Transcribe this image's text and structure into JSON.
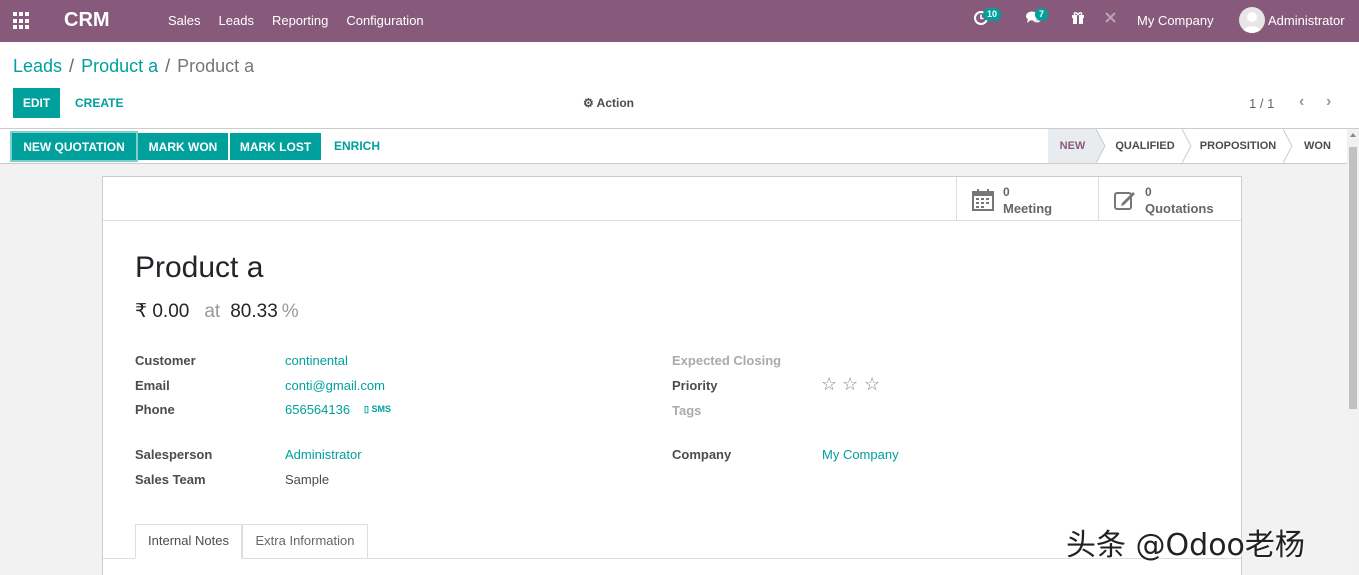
{
  "navbar": {
    "brand": "CRM",
    "menu": [
      "Sales",
      "Leads",
      "Reporting",
      "Configuration"
    ],
    "activity_count": "10",
    "message_count": "7",
    "company": "My Company",
    "user": "Administrator"
  },
  "breadcrumb": {
    "items": [
      "Leads",
      "Product a"
    ],
    "current": "Product a"
  },
  "buttons": {
    "edit": "EDIT",
    "create": "CREATE",
    "action": "Action",
    "new_quotation": "NEW QUOTATION",
    "mark_won": "MARK WON",
    "mark_lost": "MARK LOST",
    "enrich": "ENRICH"
  },
  "pager": {
    "value": "1 / 1"
  },
  "stages": {
    "items": [
      "NEW",
      "QUALIFIED",
      "PROPOSITION",
      "WON"
    ],
    "active": "NEW"
  },
  "smart_buttons": [
    {
      "value": "0",
      "label": "Meeting"
    },
    {
      "value": "0",
      "label": "Quotations"
    }
  ],
  "record": {
    "name": "Product a",
    "revenue": "₹ 0.00",
    "at": "at",
    "probability": "80.33",
    "percent": "%"
  },
  "fields": {
    "customer_label": "Customer",
    "customer": "continental",
    "email_label": "Email",
    "email": "conti@gmail.com",
    "phone_label": "Phone",
    "phone": "656564136",
    "sms": "SMS",
    "salesperson_label": "Salesperson",
    "salesperson": "Administrator",
    "sales_team_label": "Sales Team",
    "sales_team": "Sample",
    "expected_closing_label": "Expected Closing",
    "priority_label": "Priority",
    "priority": 0,
    "tags_label": "Tags",
    "company_label": "Company",
    "company": "My Company"
  },
  "tabs": [
    "Internal Notes",
    "Extra Information"
  ],
  "watermark": "头条 @Odoo老杨",
  "colors": {
    "navbar": "#875a7b",
    "accent": "#00a09d"
  }
}
